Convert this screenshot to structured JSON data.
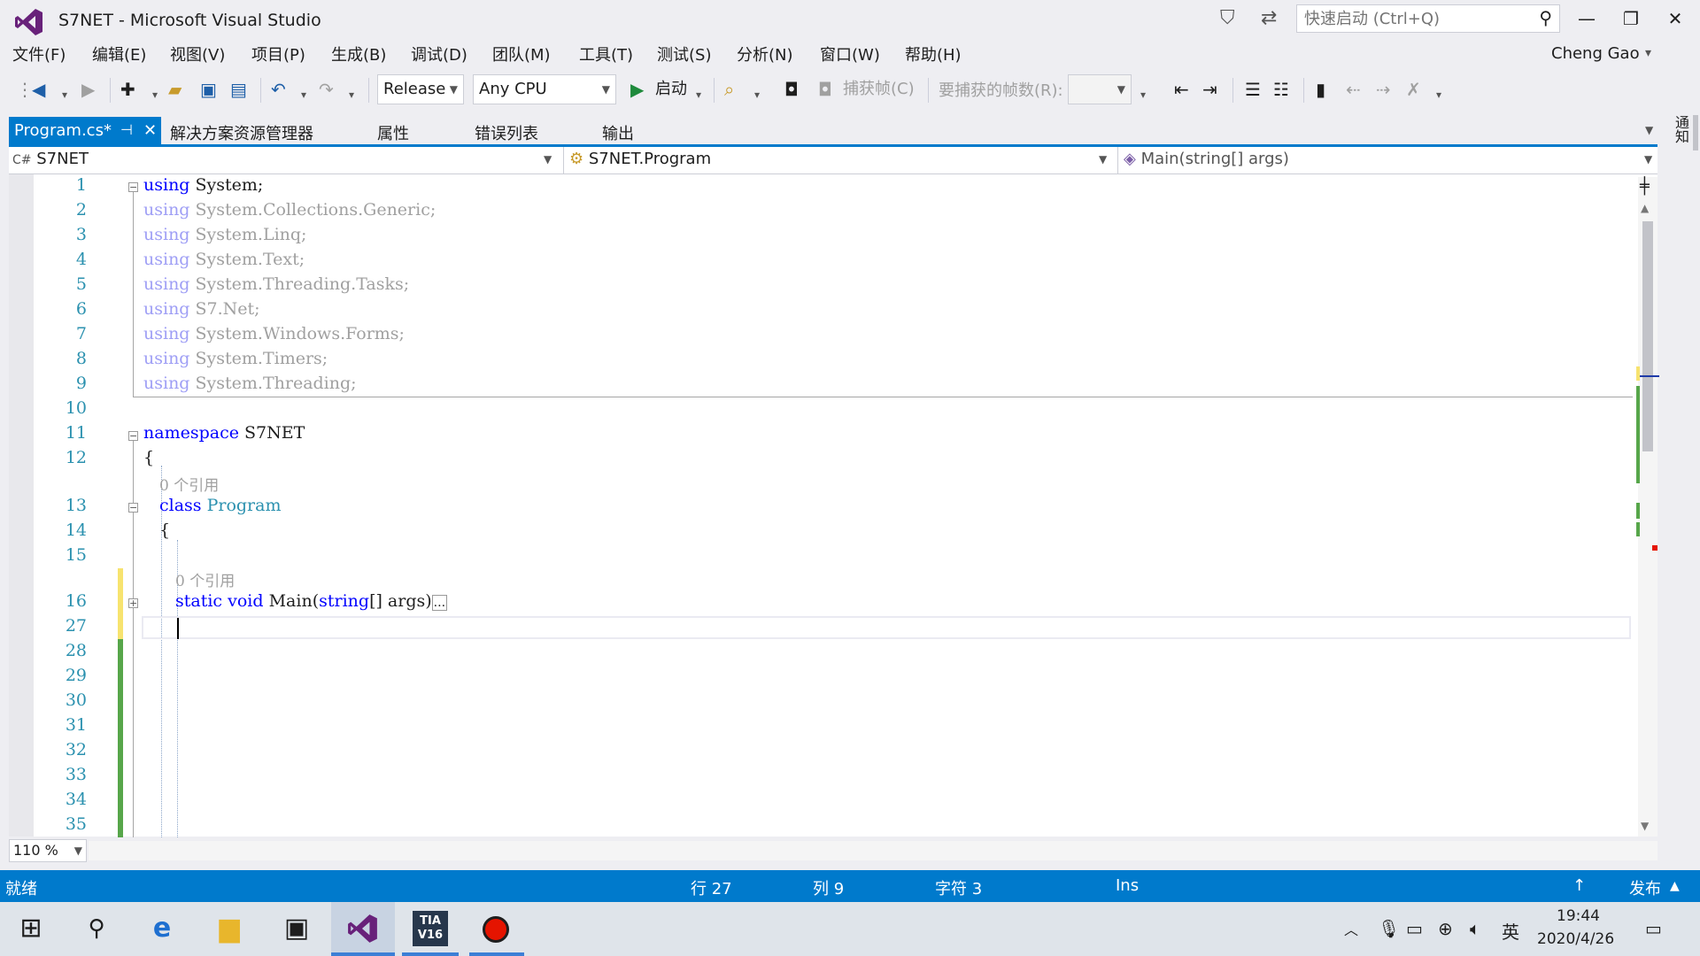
{
  "window": {
    "title": "S7NET - Microsoft Visual Studio",
    "quick_launch_placeholder": "快速启动 (Ctrl+Q)",
    "user": "Cheng Gao"
  },
  "menu": [
    "文件(F)",
    "编辑(E)",
    "视图(V)",
    "项目(P)",
    "生成(B)",
    "调试(D)",
    "团队(M)",
    "工具(T)",
    "测试(S)",
    "分析(N)",
    "窗口(W)",
    "帮助(H)"
  ],
  "toolbar": {
    "config": "Release",
    "platform": "Any CPU",
    "start_label": "启动",
    "capture_label": "捕获帧(C)",
    "frames_label": "要捕获的帧数(R):"
  },
  "tabs": {
    "active": "Program.cs*",
    "others": [
      "解决方案资源管理器",
      "属性",
      "错误列表",
      "输出"
    ]
  },
  "side_panel_label": "通知",
  "navbar": {
    "project": "S7NET",
    "class": "S7NET.Program",
    "member": "Main(string[] args)"
  },
  "editor": {
    "line_numbers": [
      "1",
      "2",
      "3",
      "4",
      "5",
      "6",
      "7",
      "8",
      "9",
      "10",
      "11",
      "12",
      "13",
      "14",
      "15",
      "16",
      "27",
      "28",
      "29",
      "30",
      "31",
      "32",
      "33",
      "34",
      "35"
    ],
    "using_first": "System;",
    "usings_dim": [
      "System.Collections.Generic;",
      "System.Linq;",
      "System.Text;",
      "System.Threading.Tasks;",
      "S7.Net;",
      "System.Windows.Forms;",
      "System.Timers;",
      "System.Threading;"
    ],
    "kw_using": "using",
    "kw_namespace": "namespace",
    "namespace_name": "S7NET",
    "brace_open": "{",
    "ref_hint": "0 个引用",
    "kw_class": "class",
    "class_name": "Program",
    "kw_static": "static",
    "kw_void": "void",
    "method_name": "Main(",
    "param_type": "string",
    "param_rest": "[] args)",
    "collapsed": "..."
  },
  "zoom": "110 %",
  "status": {
    "state": "就绪",
    "line": "行 27",
    "col": "列 9",
    "char": "字符 3",
    "mode": "Ins",
    "publish": "发布"
  },
  "taskbar": {
    "time": "19:44",
    "date": "2020/4/26",
    "ime": "英",
    "tia_label": "TIA V16"
  }
}
